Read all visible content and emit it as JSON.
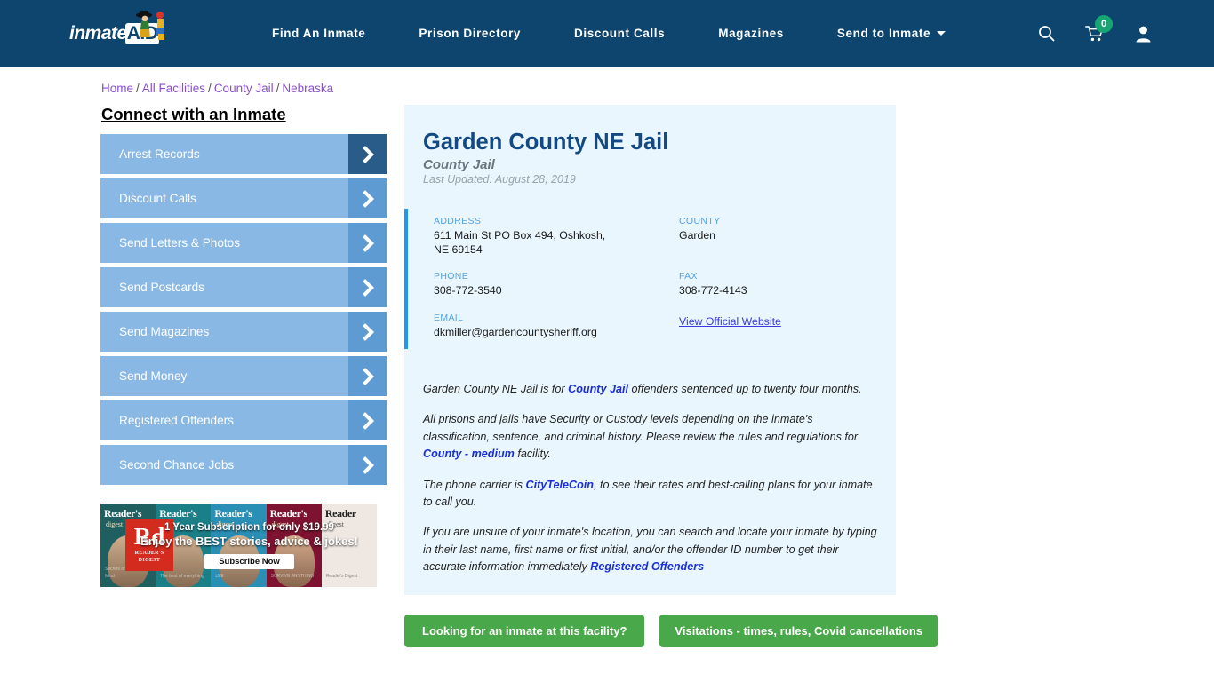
{
  "navbar": {
    "brand": {
      "text": "inmate",
      "accent": "AID",
      "icon": "logo-figure-icon"
    },
    "links": [
      {
        "label": "Find An Inmate",
        "dropdown": false
      },
      {
        "label": "Prison Directory",
        "dropdown": false
      },
      {
        "label": "Discount Calls",
        "dropdown": false
      },
      {
        "label": "Magazines",
        "dropdown": false
      },
      {
        "label": "Send to Inmate",
        "dropdown": true
      }
    ],
    "icons": {
      "search": "search-icon",
      "cart": "shopping-cart-icon",
      "cart_count": "0",
      "account": "user-account-icon"
    },
    "bg_color": "#0d456f",
    "badge_color": "#17a673"
  },
  "breadcrumb": {
    "items": [
      "Home",
      "All Facilities",
      "County Jail",
      "Nebraska"
    ],
    "separator": "/",
    "link_color": "#8a4fce"
  },
  "sidebar": {
    "title": "Connect with an Inmate",
    "items": [
      {
        "label": "Arrest Records",
        "active": true
      },
      {
        "label": "Discount Calls",
        "active": false
      },
      {
        "label": "Send Letters & Photos",
        "active": false
      },
      {
        "label": "Send Postcards",
        "active": false
      },
      {
        "label": "Send Magazines",
        "active": false
      },
      {
        "label": "Send Money",
        "active": false
      },
      {
        "label": "Registered Offenders",
        "active": false
      },
      {
        "label": "Second Chance Jobs",
        "active": false
      }
    ],
    "item_color": "#8ab8e4",
    "arrow_color": "#5f9bd3",
    "arrow_active_color": "#2a5c8a"
  },
  "ad": {
    "brand_big": "Rd",
    "brand_small": "READER'S\nDIGEST",
    "line1": "1 Year Subscription for only $19.99",
    "line2": "Enjoy the BEST stories, advice & jokes!",
    "button": "Subscribe Now",
    "covers": [
      {
        "title": "Reader's",
        "sub": "digest",
        "body": "Secrets of a Calmer Mind"
      },
      {
        "title": "Reader's",
        "sub": "digest",
        "body": "The best of everything"
      },
      {
        "title": "Reader's",
        "sub": "digest",
        "body": "LEE"
      },
      {
        "title": "Reader's",
        "sub": "digest",
        "body": "SURVIVE ANYTHING"
      },
      {
        "title": "Reader",
        "sub": "digest",
        "body": "Reader's Digest"
      }
    ]
  },
  "facility": {
    "name": "Garden County NE Jail",
    "type": "County Jail",
    "last_updated": "Last Updated: August 28, 2019",
    "title_color": "#134a83",
    "panel_bg": "#e9f6fe",
    "accent_bar": "#2196f3",
    "fields": [
      {
        "label": "ADDRESS",
        "value": "611 Main St PO Box 494, Oshkosh, NE 69154",
        "link": false
      },
      {
        "label": "COUNTY",
        "value": "Garden",
        "link": false
      },
      {
        "label": "PHONE",
        "value": "308-772-3540",
        "link": false
      },
      {
        "label": "FAX",
        "value": "308-772-4143",
        "link": false
      },
      {
        "label": "EMAIL",
        "value": "dkmiller@gardencountysheriff.org",
        "link": false
      },
      {
        "label": "",
        "value": "View Official Website",
        "link": true
      }
    ]
  },
  "description": {
    "p1_a": "Garden County NE Jail is for ",
    "p1_link": "County Jail",
    "p1_b": " offenders sentenced up to twenty four months.",
    "p2_a": "All prisons and jails have Security or Custody levels depending on the inmate's classification, sentence, and criminal history. Please review the rules and regulations for ",
    "p2_link": "County - medium",
    "p2_b": " facility.",
    "p3_a": "The phone carrier is ",
    "p3_link": "CityTeleCoin",
    "p3_b": ", to see their rates and best-calling plans for your inmate to call you.",
    "p4_a": "If you are unsure of your inmate's location, you can search and locate your inmate by typing in their last name, first name or first initial, and/or the offender ID number to get their accurate information immediately ",
    "p4_link": "Registered Offenders",
    "p4_b": ""
  },
  "cta": {
    "primary": "Looking for an inmate at this facility?",
    "secondary": "Visitations - times, rules, Covid cancellations",
    "color": "#49a849"
  }
}
